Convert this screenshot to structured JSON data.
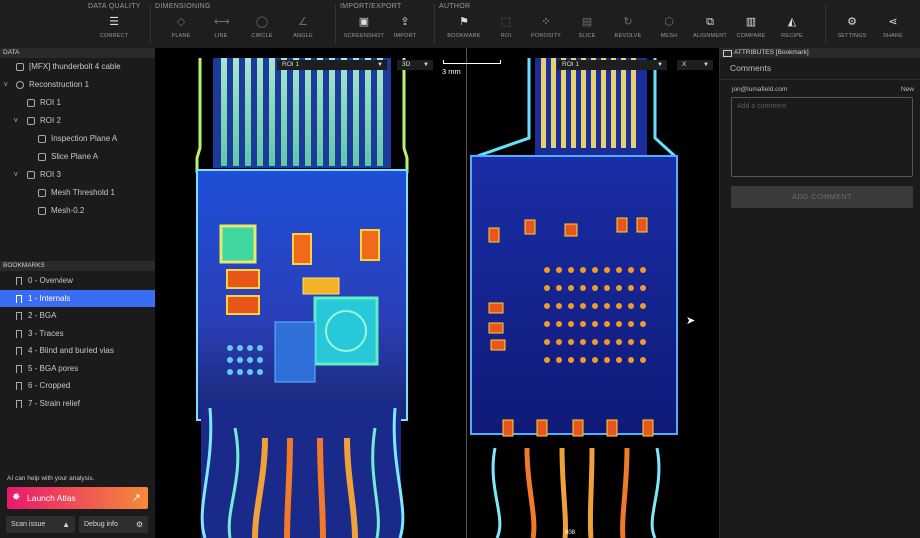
{
  "toolbar": {
    "groups": [
      {
        "label": "DATA QUALITY",
        "buttons": [
          {
            "label": "CORRECT",
            "icon": "sliders-icon"
          }
        ]
      },
      {
        "label": "DIMENSIONING",
        "buttons": [
          {
            "label": "PLANE"
          },
          {
            "label": "LINE"
          },
          {
            "label": "CIRCLE"
          },
          {
            "label": "ANGLE"
          }
        ]
      },
      {
        "label": "IMPORT/EXPORT",
        "buttons": [
          {
            "label": "SCREENSHOT"
          },
          {
            "label": "IMPORT"
          }
        ]
      },
      {
        "label": "AUTHOR",
        "buttons": [
          {
            "label": "BOOKMARK"
          },
          {
            "label": "ROI"
          },
          {
            "label": "POROSITY"
          },
          {
            "label": "SLICE"
          },
          {
            "label": "REVOLVE"
          },
          {
            "label": "MESH"
          },
          {
            "label": "ALIGNMENT"
          },
          {
            "label": "COMPARE"
          },
          {
            "label": "RECIPE"
          }
        ]
      }
    ],
    "settings_label": "SETTINGS",
    "share_label": "SHARE"
  },
  "data_panel": {
    "header": "DATA",
    "tree": [
      {
        "label": "[MFX] thunderbolt 4 cable",
        "depth": 0,
        "expander": ""
      },
      {
        "label": "Reconstruction 1",
        "depth": 0,
        "expander": "v"
      },
      {
        "label": "ROI 1",
        "depth": 1,
        "expander": ""
      },
      {
        "label": "ROI 2",
        "depth": 1,
        "expander": "v"
      },
      {
        "label": "Inspection Plane A",
        "depth": 2,
        "expander": ""
      },
      {
        "label": "Slice Plane A",
        "depth": 2,
        "expander": ""
      },
      {
        "label": "ROI 3",
        "depth": 1,
        "expander": "v"
      },
      {
        "label": "Mesh Threshold 1",
        "depth": 2,
        "expander": ""
      },
      {
        "label": "Mesh-0.2",
        "depth": 2,
        "expander": ""
      }
    ]
  },
  "bookmarks": {
    "header": "BOOKMARKS",
    "items": [
      {
        "label": "0 - Overview",
        "selected": false
      },
      {
        "label": "1 - Internals",
        "selected": true
      },
      {
        "label": "2 - BGA",
        "selected": false
      },
      {
        "label": "3 - Traces",
        "selected": false
      },
      {
        "label": "4 - Blind and buried vias",
        "selected": false
      },
      {
        "label": "5 - BGA pores",
        "selected": false
      },
      {
        "label": "6 - Cropped",
        "selected": false
      },
      {
        "label": "7 - Strain relief",
        "selected": false
      }
    ]
  },
  "ai": {
    "help_text": "AI can help with your analysis.",
    "launch_label": "Launch Atlas",
    "scan_issue_label": "Scan issue",
    "debug_label": "Debug info"
  },
  "viewport": {
    "left_roi_select": "ROI 1",
    "left_mode_select": "3D",
    "scale_label": "3 mm",
    "right_roi_select": "ROI 1",
    "right_axis_select": "X",
    "slice_badge": "808"
  },
  "attributes": {
    "header": "ATTRIBUTES [Bookmark]",
    "comments_title": "Comments",
    "user": "jon@lumafield.com",
    "new_label": "New",
    "placeholder": "Add a comment",
    "add_button": "ADD COMMENT"
  },
  "colors": {
    "accent": "#3a6cf4",
    "atlas_gradient_start": "#e8196e",
    "atlas_gradient_end": "#f58a3a"
  }
}
